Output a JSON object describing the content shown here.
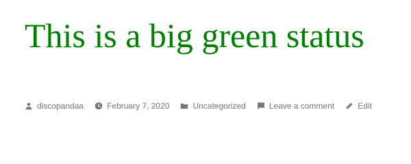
{
  "post": {
    "title": "This is a big green status",
    "title_color": "#008000"
  },
  "meta": {
    "text_color": "#767676",
    "author": {
      "label": "discopandaa",
      "icon": "person-icon"
    },
    "date": {
      "label": "February 7, 2020",
      "icon": "clock-icon"
    },
    "category": {
      "label": "Uncategorized",
      "icon": "folder-icon"
    },
    "comment": {
      "label": "Leave a comment",
      "icon": "comment-icon"
    },
    "edit": {
      "label": "Edit",
      "icon": "pencil-icon"
    }
  }
}
